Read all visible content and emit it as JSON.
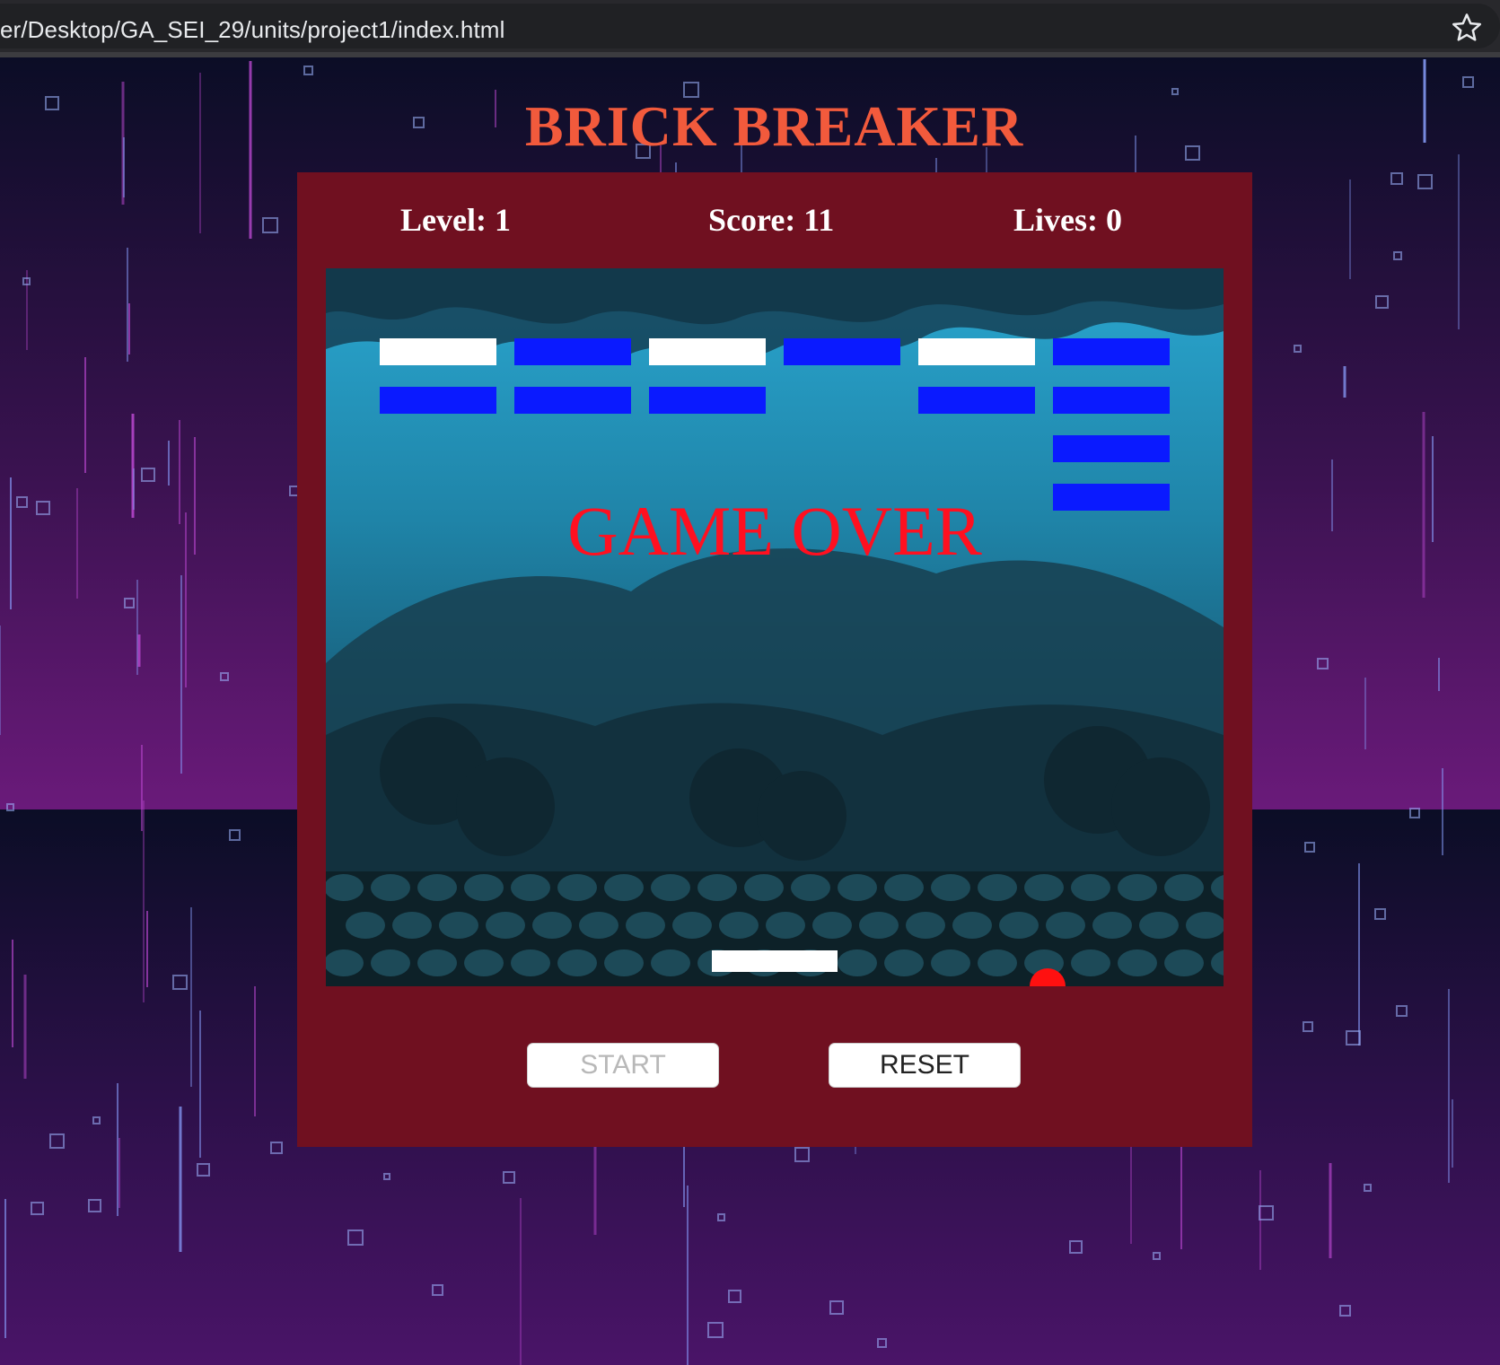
{
  "browser": {
    "url": "er/Desktop/GA_SEI_29/units/project1/index.html"
  },
  "game": {
    "title": "BRICK BREAKER",
    "level_text": "Level: 1",
    "score_text": "Score: 11",
    "lives_text": "Lives: 0",
    "level": 1,
    "score": 11,
    "lives": 0,
    "status_message": "GAME OVER",
    "bricks": [
      {
        "row": 0,
        "col": 0,
        "color": "#ffffff"
      },
      {
        "row": 0,
        "col": 1,
        "color": "#0a1aff"
      },
      {
        "row": 0,
        "col": 2,
        "color": "#ffffff"
      },
      {
        "row": 0,
        "col": 3,
        "color": "#0a1aff"
      },
      {
        "row": 0,
        "col": 4,
        "color": "#ffffff"
      },
      {
        "row": 0,
        "col": 5,
        "color": "#0a1aff"
      },
      {
        "row": 1,
        "col": 0,
        "color": "#0a1aff"
      },
      {
        "row": 1,
        "col": 1,
        "color": "#0a1aff"
      },
      {
        "row": 1,
        "col": 2,
        "color": "#0a1aff"
      },
      {
        "row": 1,
        "col": 4,
        "color": "#0a1aff"
      },
      {
        "row": 1,
        "col": 5,
        "color": "#0a1aff"
      },
      {
        "row": 2,
        "col": 5,
        "color": "#0a1aff"
      },
      {
        "row": 3,
        "col": 5,
        "color": "#0a1aff"
      }
    ]
  },
  "controls": {
    "start_label": "START",
    "reset_label": "RESET",
    "start_enabled": false
  },
  "icons": {
    "bookmark": "star-icon"
  },
  "colors": {
    "title": "#f25a3c",
    "panel": "#701020",
    "game_over": "#ff1020",
    "brick_blue": "#0a1aff",
    "brick_white": "#ffffff",
    "ball": "#ff1010"
  }
}
